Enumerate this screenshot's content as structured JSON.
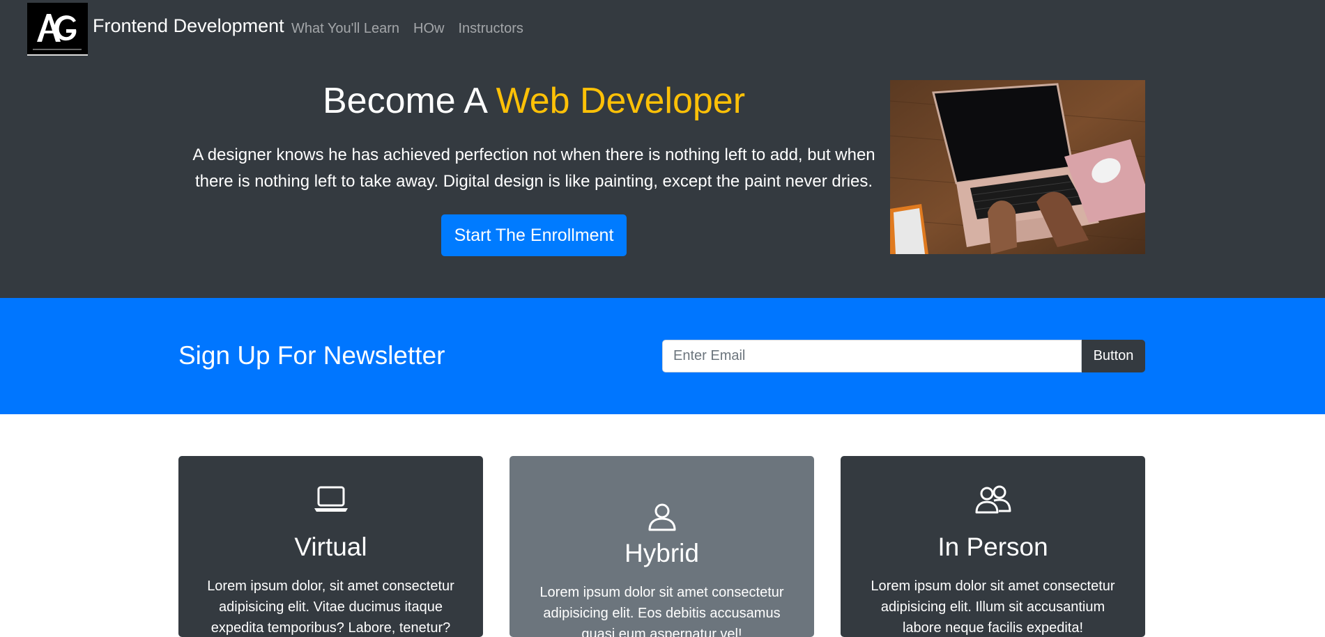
{
  "navbar": {
    "logo_text": "AG",
    "brand": "Frontend Development",
    "links": [
      "What You'll Learn",
      "HOw",
      "Instructors"
    ]
  },
  "hero": {
    "title_prefix": "Become A ",
    "title_accent": "Web Developer",
    "lead": "A designer knows he has achieved perfection not when there is nothing left to add, but when there is nothing left to take away. Digital design is like painting, except the paint never dries.",
    "button": "Start The Enrollment"
  },
  "newsletter": {
    "title": "Sign Up For Newsletter",
    "placeholder": "Enter Email",
    "button": "Button"
  },
  "cards": [
    {
      "icon": "laptop-icon",
      "title": "Virtual",
      "text": "Lorem ipsum dolor, sit amet consectetur adipisicing elit. Vitae ducimus itaque expedita temporibus? Labore, tenetur?"
    },
    {
      "icon": "person-icon",
      "title": "Hybrid",
      "text": "Lorem ipsum dolor sit amet consectetur adipisicing elit. Eos debitis accusamus quasi eum aspernatur vel!"
    },
    {
      "icon": "people-icon",
      "title": "In Person",
      "text": "Lorem ipsum dolor sit amet consectetur adipisicing elit. Illum sit accusantium labore neque facilis expedita!"
    }
  ],
  "colors": {
    "dark": "#343a40",
    "primary": "#007bff",
    "newsletter_bg": "#0076ff",
    "accent": "#ffc107",
    "gray": "#6c757d"
  }
}
